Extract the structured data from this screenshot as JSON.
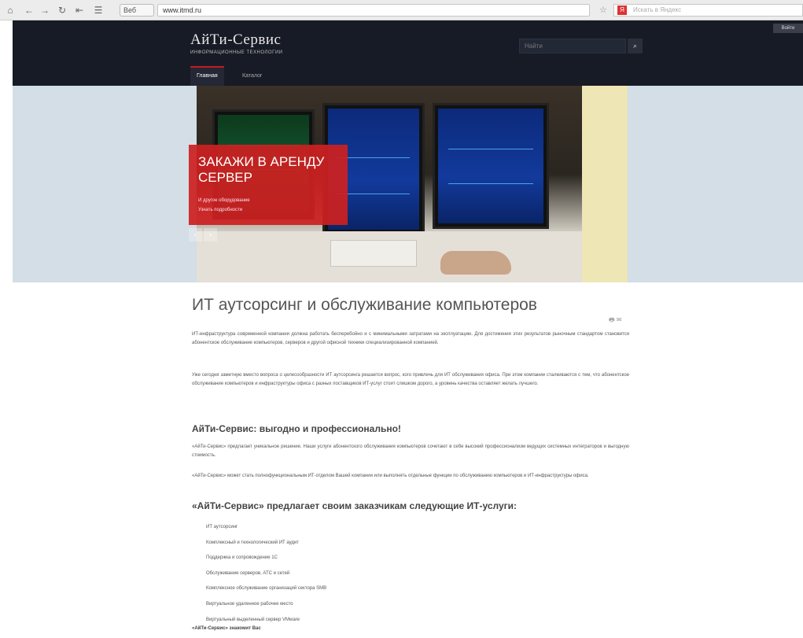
{
  "browser": {
    "site_badge": "Веб",
    "url": "www.itmd.ru",
    "search_placeholder": "Искать в Яндекс",
    "search_engine_letter": "Я"
  },
  "header": {
    "logo_title": "АйТи-Сервис",
    "logo_subtitle": "информационные технологии",
    "search_placeholder": "Найти",
    "search_button": "⌕",
    "corner_link": "Войти",
    "menu": [
      {
        "label": "Главная",
        "active": true
      },
      {
        "label": "Каталог",
        "active": false
      }
    ]
  },
  "hero": {
    "promo_title": "ЗАКАЖИ В АРЕНДУ СЕРВЕР",
    "promo_line1": "И другое оборудование",
    "promo_line2": "Узнать подробности",
    "prev": "‹",
    "next": "›"
  },
  "article": {
    "title": "ИТ аутсорсинг и обслуживание компьютеров",
    "print_icons": "🖶 ✉",
    "p1": "ИТ-инфраструктура современной компании должна работать бесперебойно и с минимальными затратами на эксплуатацию. Для достижения этих результатов рыночным стандартом становится абонентское обслуживание компьютеров, серверов и другой офисной техники специализированной компанией.",
    "p2": "Уже сегодня заметную вместо вопроса о целесообразности ИТ аутсорсинга решается вопрос, кого привлечь для ИТ обслуживания офиса. При этом компании сталкиваются с тем, что абонентское обслуживание компьютеров и инфраструктуры офиса с разных поставщиков ИТ-услуг стоит слишком дорого, а уровень качества оставляет желать лучшего.",
    "h2": "АйТи-Сервис: выгодно и профессионально!",
    "p3": "«АйТи-Сервис» предлагает уникальное решение. Наши услуги абонентского обслуживания компьютеров сочетают в себе высокий профессионализм ведущих системных интеграторов и выгодную стоимость.",
    "p4": "«АйТи-Сервис» может стать полнофункциональным ИТ-отделом Вашей компании или выполнять отдельные функции по обслуживанию компьютеров и ИТ-инфраструктуры офиса.",
    "h3": "«АйТи-Сервис» предлагает своим заказчикам следующие ИТ-услуги:",
    "services": [
      "ИТ аутсорсинг",
      "Комплексный и технологический ИТ аудит",
      "Поддержка и сопровождение 1С",
      "Обслуживание серверов, АТС и сетей",
      "Комплексное обслуживание организаций сектора SMB",
      "Виртуальное удаленное рабочее место",
      "Виртуальный выделенный сервер VMware"
    ],
    "footnote": "«АйТи-Сервис» знакомит Вас"
  }
}
